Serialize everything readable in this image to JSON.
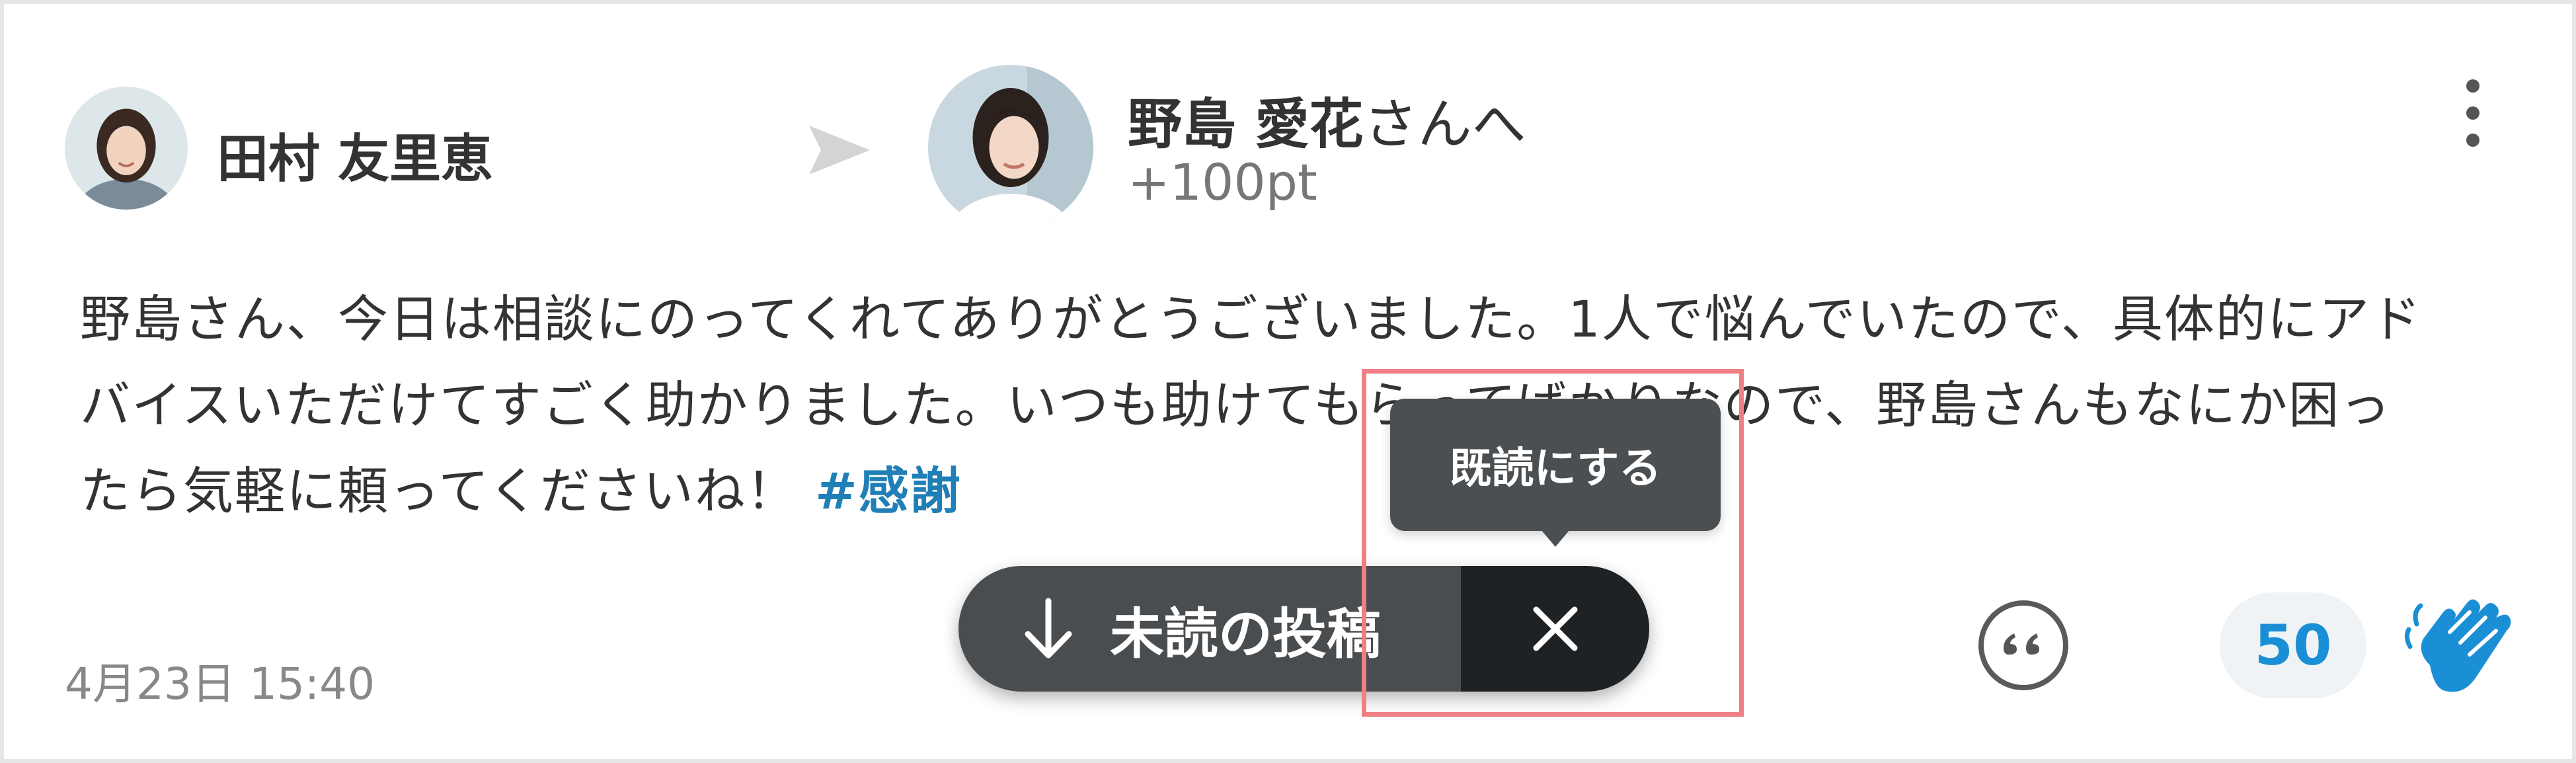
{
  "post": {
    "sender": {
      "name": "田村 友里恵"
    },
    "recipient": {
      "name": "野島 愛花",
      "suffix": "さんへ",
      "points": "+100pt"
    },
    "message": {
      "line1": "野島さん、今日は相談にのってくれてありがとうございました。1人で悩んでいたので、具体的にアド",
      "line2": "バイスいただけてすごく助かりました。いつも助けてもらってばかりなので、野島さんもなにか困っ",
      "line3": "たら気軽に頼ってくださいね！",
      "hashtag": "#感謝"
    },
    "timestamp": "4月23日 15:40",
    "applause_count": "50"
  },
  "tooltip": {
    "label": "既読にする"
  },
  "unread_banner": {
    "label": "未読の投稿"
  },
  "icons": {
    "sender_avatar": "avatar",
    "send_arrow": "send-arrow-icon",
    "recipient_avatar": "avatar",
    "more": "vertical-dots-icon",
    "arrow_down": "arrow-down-icon",
    "close": "close-icon",
    "quote": "quote-icon",
    "clap": "clapping-hands-icon"
  },
  "colors": {
    "hashtag": "#1f7fb6",
    "count": "#1b8fd6",
    "clap": "#1b8fd6",
    "pill_main": "#4a4d4f",
    "pill_close": "#1f2224",
    "highlight": "#ef7f85"
  }
}
